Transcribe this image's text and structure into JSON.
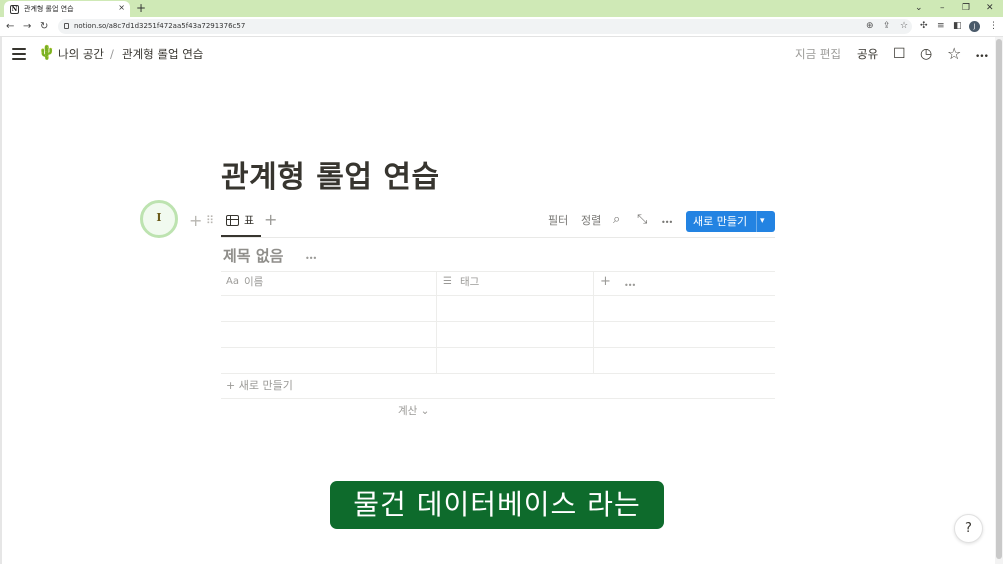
{
  "browser": {
    "tab_title": "관계형 롤업 연습",
    "tab_close": "×",
    "new_tab": "+",
    "favicon": "N",
    "url": "notion.so/a8c7d1d3251f472aa5f43a7291376c57",
    "profile_initial": "J",
    "win_chevron": "⌄",
    "win_minimize": "–",
    "win_restore": "❐",
    "win_close": "✕",
    "nav_back": "←",
    "nav_forward": "→",
    "nav_reload": "↻",
    "zoom_icon": "⊕",
    "share_icon": "⇪",
    "star_icon": "☆",
    "ext_puzzle": "✣",
    "ext_media": "≡",
    "ext_sidepanel": "◧",
    "menu_dots": "⋮"
  },
  "topbar": {
    "workspace_icon": "🌵",
    "breadcrumb_root": "나의 공간",
    "breadcrumb_sep": "/",
    "breadcrumb_page": "관계형 롤업 연습",
    "edited": "지금 편집",
    "share": "공유",
    "comment_icon": "☐",
    "history_icon": "◷",
    "favorite_icon": "☆",
    "more_icon": "•••"
  },
  "page": {
    "title": "관계형 롤업 연습",
    "cursor_glyph": "I",
    "block_add": "+",
    "block_drag": "⠿"
  },
  "database": {
    "view_tab_label": "표",
    "view_add": "+",
    "filter": "필터",
    "sort": "정렬",
    "search_icon": "⌕",
    "expand_icon": "⤡",
    "more_icon": "•••",
    "new_button": "새로 만들기",
    "new_chevron": "▾",
    "title": "제목 없음",
    "title_more": "•••",
    "columns": [
      {
        "icon": "Aa",
        "label": "이름"
      },
      {
        "icon": "☰",
        "label": "태그"
      }
    ],
    "add_column": "+",
    "column_more": "•••",
    "rows": [
      {
        "name": "",
        "tags": ""
      },
      {
        "name": "",
        "tags": ""
      },
      {
        "name": "",
        "tags": ""
      }
    ],
    "add_row": "+ 새로 만들기",
    "calculate": "계산 ⌄"
  },
  "overlay": {
    "subtitle": "물건 데이터베이스 라는"
  },
  "help": "?"
}
